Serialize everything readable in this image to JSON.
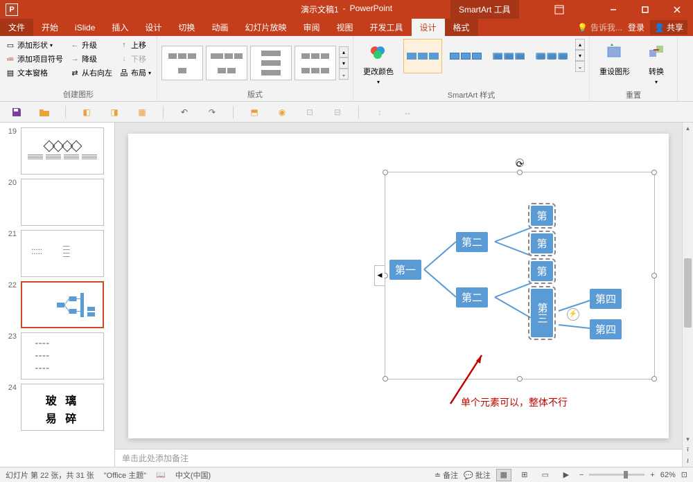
{
  "title": {
    "doc": "演示文稿1",
    "app": "PowerPoint",
    "tools": "SmartArt 工具"
  },
  "tabs": {
    "file": "文件",
    "home": "开始",
    "islide": "iSlide",
    "insert": "插入",
    "design": "设计",
    "transitions": "切换",
    "animations": "动画",
    "slideshow": "幻灯片放映",
    "review": "审阅",
    "view": "视图",
    "developer": "开发工具",
    "sa_design": "设计",
    "sa_format": "格式",
    "tellme": "告诉我...",
    "login": "登录",
    "share": "共享"
  },
  "ribbon": {
    "add_shape": "添加形状",
    "add_bullet": "添加项目符号",
    "text_pane": "文本窗格",
    "promote": "升级",
    "demote": "降级",
    "rtl": "从右向左",
    "move_up": "上移",
    "move_down": "下移",
    "layout": "布局",
    "group_create": "创建图形",
    "group_layouts": "版式",
    "change_colors": "更改颜色",
    "group_styles": "SmartArt 样式",
    "reset": "重设图形",
    "convert": "转换",
    "group_reset": "重置"
  },
  "slide": {
    "box1": "第一",
    "box2a": "第二",
    "box2b": "第二",
    "box3a": "第",
    "box3b": "第",
    "box3c": "第",
    "box3d": "第三",
    "box4a": "第四",
    "box4b": "第四",
    "annotation": "单个元素可以，整体不行",
    "notes_placeholder": "单击此处添加备注"
  },
  "thumbs": {
    "n19": "19",
    "n20": "20",
    "n21": "21",
    "n22": "22",
    "n23": "23",
    "n24": "24",
    "t24a": "玻  璃",
    "t24b": "易  碎"
  },
  "status": {
    "slide_info": "幻灯片 第 22 张，共 31 张",
    "theme": "\"Office 主题\"",
    "lang": "中文(中国)",
    "notes": "备注",
    "comments": "批注",
    "zoom": "62%"
  }
}
